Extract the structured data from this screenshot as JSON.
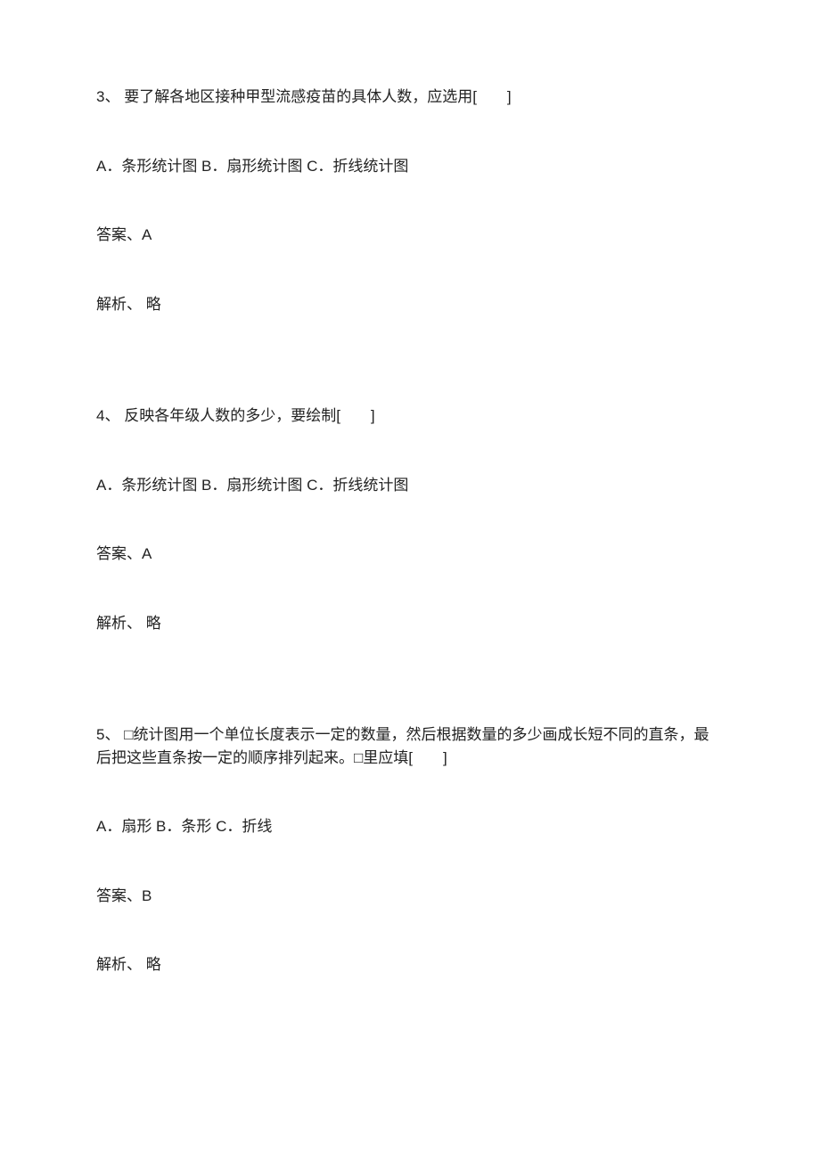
{
  "questions": [
    {
      "number": "3、",
      "stem": " 要了解各地区接种甲型流感疫苗的具体人数，应选用[　　]",
      "options": "A．条形统计图 B．扇形统计图 C．折线统计图",
      "answer_label": "答案、",
      "answer": "A",
      "explain_label": "解析、",
      "explain": " 略"
    },
    {
      "number": "4、",
      "stem": " 反映各年级人数的多少，要绘制[　　]",
      "options": "A．条形统计图 B．扇形统计图 C．折线统计图",
      "answer_label": "答案、",
      "answer": "A",
      "explain_label": "解析、",
      "explain": " 略"
    },
    {
      "number": "5、",
      "stem": " □统计图用一个单位长度表示一定的数量，然后根据数量的多少画成长短不同的直条，最后把这些直条按一定的顺序排列起来。□里应填[　　]",
      "options": "A．扇形 B．条形 C．折线",
      "answer_label": "答案、",
      "answer": "B",
      "explain_label": "解析、",
      "explain": " 略"
    }
  ]
}
